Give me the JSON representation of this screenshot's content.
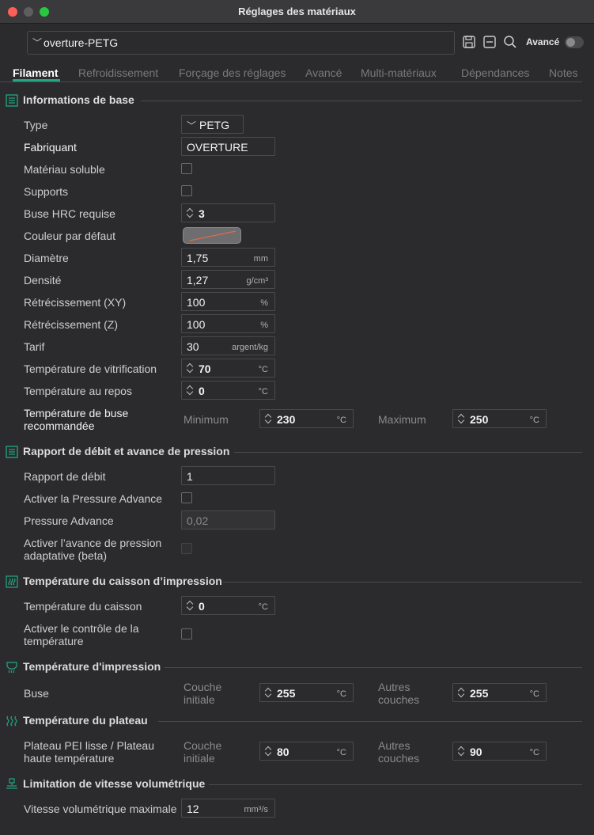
{
  "window": {
    "title": "Réglages des matériaux"
  },
  "preset": {
    "value": "overture-PETG",
    "advanced_label": "Avancé"
  },
  "tabs": [
    "Filament",
    "Refroidissement",
    "Forçage des réglages",
    "Avancé",
    "Multi-matériaux",
    "Dépendances",
    "Notes"
  ],
  "sections": {
    "basic": "Informations de base",
    "flow": "Rapport de débit et avance de pression",
    "chamber": "Température du caisson d’impression",
    "print_temp": "Température d'impression",
    "bed_temp": "Température du plateau",
    "volumetric": "Limitation de vitesse volumétrique"
  },
  "basic": {
    "type_label": "Type",
    "type_value": "PETG",
    "vendor_label": "Fabriquant",
    "vendor_value": "OVERTURE",
    "soluble_label": "Matériau soluble",
    "supports_label": "Supports",
    "hrc_label": "Buse HRC requise",
    "hrc_value": "3",
    "color_label": "Couleur par défaut",
    "diameter_label": "Diamètre",
    "diameter_value": "1,75",
    "diameter_unit": "mm",
    "density_label": "Densité",
    "density_value": "1,27",
    "density_unit": "g/cm³",
    "shrink_xy_label": "Rétrécissement (XY)",
    "shrink_xy_value": "100",
    "shrink_xy_unit": "%",
    "shrink_z_label": "Rétrécissement (Z)",
    "shrink_z_value": "100",
    "shrink_z_unit": "%",
    "cost_label": "Tarif",
    "cost_value": "30",
    "cost_unit": "argent/kg",
    "glass_label": "Température de vitrification",
    "glass_value": "70",
    "glass_unit": "°C",
    "rest_label": "Température au repos",
    "rest_value": "0",
    "rest_unit": "°C",
    "nozzle_rec_label_1": "Température de buse",
    "nozzle_rec_label_2": "recommandée",
    "min_label": "Minimum",
    "min_value": "230",
    "min_unit": "°C",
    "max_label": "Maximum",
    "max_value": "250",
    "max_unit": "°C"
  },
  "flow": {
    "ratio_label": "Rapport de débit",
    "ratio_value": "1",
    "pa_enable_label": "Activer la Pressure Advance",
    "pa_label": "Pressure Advance",
    "pa_value": "0,02",
    "adaptive_label_1": "Activer l’avance de pression",
    "adaptive_label_2": "adaptative (beta)"
  },
  "chamber": {
    "temp_label": "Température du caisson",
    "temp_value": "0",
    "temp_unit": "°C",
    "control_label_1": "Activer le contrôle de la",
    "control_label_2": "température"
  },
  "print_temp": {
    "nozzle_label": "Buse",
    "initial_label_1": "Couche",
    "initial_label_2": "initiale",
    "initial_value": "255",
    "initial_unit": "°C",
    "other_label_1": "Autres",
    "other_label_2": "couches",
    "other_value": "255",
    "other_unit": "°C"
  },
  "bed_temp": {
    "plate_label_1": "Plateau PEI lisse / Plateau",
    "plate_label_2": "haute température",
    "initial_label_1": "Couche",
    "initial_label_2": "initiale",
    "initial_value": "80",
    "initial_unit": "°C",
    "other_label_1": "Autres",
    "other_label_2": "couches",
    "other_value": "90",
    "other_unit": "°C"
  },
  "volumetric": {
    "max_label": "Vitesse volumétrique maximale",
    "max_value": "12",
    "max_unit": "mm³/s"
  },
  "colors": {
    "accent": "#1fa882",
    "default_filament_color": "#6e6e70"
  }
}
